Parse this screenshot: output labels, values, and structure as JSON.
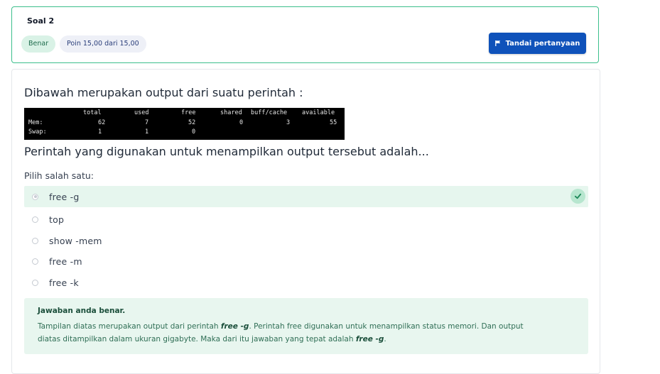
{
  "header": {
    "title": "Soal 2",
    "status_badge": "Benar",
    "points_badge": "Poin 15,00 dari 15,00",
    "flag_button": "Tandai pertanyaan",
    "border_color": "#3cbf8c",
    "button_color": "#0f52ba"
  },
  "question": {
    "prompt": "Dibawah merupakan output dari suatu perintah :",
    "terminal": {
      "headers": [
        "total",
        "used",
        "free",
        "shared",
        "buff/cache",
        "available"
      ],
      "rows": [
        [
          "Mem:",
          "62",
          "7",
          "52",
          "0",
          "3",
          "55"
        ],
        [
          "Swap:",
          "1",
          "1",
          "0",
          "",
          "",
          ""
        ]
      ]
    },
    "text": "Perintah yang digunakan untuk menampilkan output tersebut adalah...",
    "choose_label": "Pilih salah satu:",
    "options": [
      {
        "label": "free -g",
        "selected": true,
        "correct": true
      },
      {
        "label": "top",
        "selected": false
      },
      {
        "label": "show -mem",
        "selected": false
      },
      {
        "label": "free -m",
        "selected": false
      },
      {
        "label": "free -k",
        "selected": false
      }
    ]
  },
  "feedback": {
    "title": "Jawaban anda benar.",
    "line1_pre": "Tampilan diatas merupakan output dari perintah ",
    "command": "free -g",
    "line1_post": ". Perintah free digunakan untuk menampilkan status memori. Dan output",
    "line2_pre": "diatas ditampilkan dalam ukuran gigabyte. Maka dari itu jawaban yang tepat adalah ",
    "line2_post": ".",
    "background": "#e8f6ef"
  }
}
